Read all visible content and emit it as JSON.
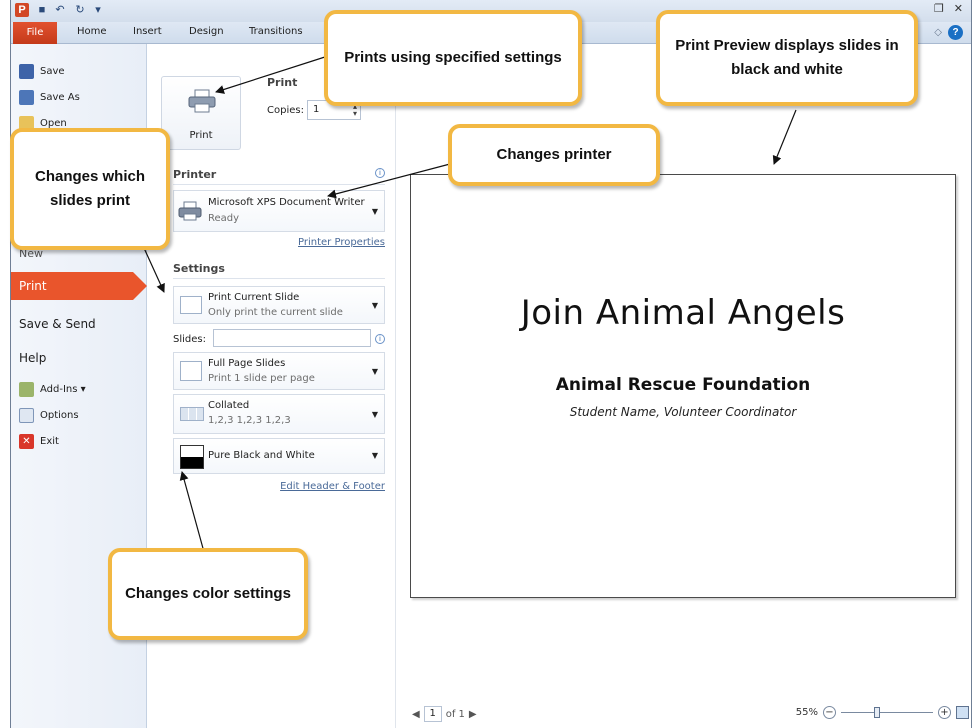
{
  "titlebar": {
    "app_logo": "P",
    "qat_icons": [
      "save-icon",
      "undo-icon",
      "redo-icon",
      "customize-qat-icon"
    ],
    "window_controls": [
      "restore-icon",
      "close-icon"
    ]
  },
  "ribbon": {
    "tabs": [
      "File",
      "Home",
      "Insert",
      "Design",
      "Transitions"
    ],
    "minimize_symbol": "◇",
    "help_symbol": "?"
  },
  "nav": {
    "save": "Save",
    "save_as": "Save As",
    "open": "Open",
    "new": "New",
    "print": "Print",
    "save_send": "Save & Send",
    "help": "Help",
    "add_ins": "Add-Ins ▾",
    "options": "Options",
    "exit": "Exit"
  },
  "print": {
    "button_label": "Print",
    "heading": "Print",
    "copies_label": "Copies:",
    "copies_value": "1"
  },
  "printer": {
    "heading": "Printer",
    "name": "Microsoft XPS Document Writer",
    "status": "Ready",
    "properties_link": "Printer Properties"
  },
  "settings": {
    "heading": "Settings",
    "slide_range_main": "Print Current Slide",
    "slide_range_sub": "Only print the current slide",
    "slides_label": "Slides:",
    "slides_value": "",
    "layout_main": "Full Page Slides",
    "layout_sub": "Print 1 slide per page",
    "collate_main": "Collated",
    "collate_sub": "1,2,3   1,2,3   1,2,3",
    "color_main": "Pure Black and White",
    "header_footer_link": "Edit Header & Footer"
  },
  "preview": {
    "slide_title": "Join Animal Angels",
    "slide_subtitle": "Animal Rescue Foundation",
    "slide_byline": "Student Name, Volunteer Coordinator",
    "page_current": "1",
    "page_total": "of 1",
    "zoom_level": "55%",
    "zoom_fraction": 0.38
  },
  "callouts": {
    "prints_settings": "Prints using specified settings",
    "print_preview": "Print Preview displays slides in black and white",
    "changes_printer": "Changes printer",
    "changes_slides": "Changes which slides print",
    "changes_color": "Changes color settings"
  },
  "colors": {
    "callout_border": "#f2b843",
    "file_tab": "#e2522f",
    "nav_selected": "#e9552c"
  }
}
